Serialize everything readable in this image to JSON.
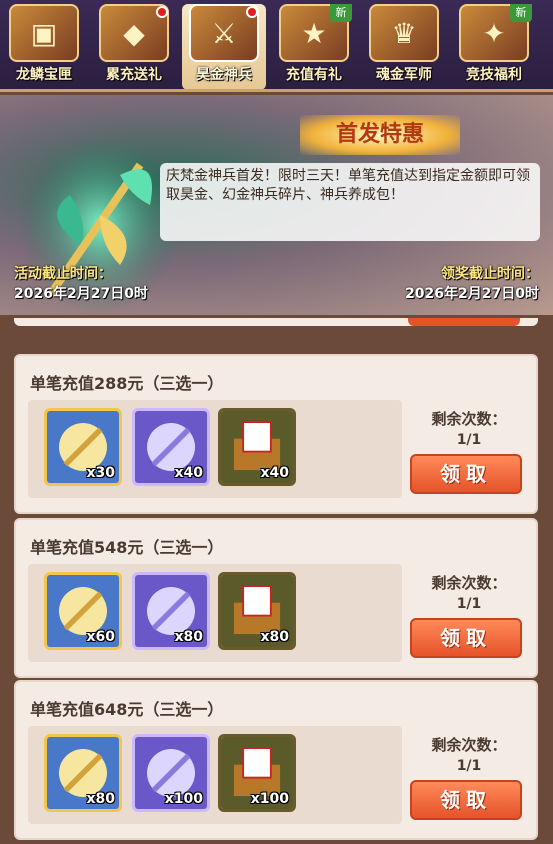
{
  "tabs": [
    {
      "label": "龙鳞宝匣",
      "icon": "treasure-chest-icon",
      "dot": false,
      "new": false,
      "active": false
    },
    {
      "label": "累充送礼",
      "icon": "gift-chest-icon",
      "dot": true,
      "new": false,
      "active": false
    },
    {
      "label": "昊金神兵",
      "icon": "weapon-icon",
      "dot": true,
      "new": false,
      "active": true
    },
    {
      "label": "充值有礼",
      "icon": "coupon-icon",
      "dot": false,
      "new": true,
      "active": false
    },
    {
      "label": "魂金军师",
      "icon": "strategist-icon",
      "dot": false,
      "new": false,
      "active": false
    },
    {
      "label": "竞技福利",
      "icon": "arena-badge-icon",
      "dot": false,
      "new": true,
      "active": false
    }
  ],
  "new_tag": "新",
  "banner": {
    "title": "首发特惠",
    "description": "庆梵金神兵首发！限时三天！单笔充值达到指定金额即可领取昊金、幻金神兵碎片、神兵养成包！",
    "activity_deadline_label": "活动截止时间：",
    "activity_deadline": "2026年2月27日0时",
    "claim_deadline_label": "领奖截止时间：",
    "claim_deadline": "2026年2月27日0时"
  },
  "cards": [
    {
      "title": "单笔充值288元（三选一）",
      "items": [
        {
          "name": "gold-weapon-shard",
          "qty": "x30"
        },
        {
          "name": "purple-weapon-shard",
          "qty": "x40"
        },
        {
          "name": "weapon-pack-chest",
          "qty": "x40"
        }
      ],
      "remain_label": "剩余次数：",
      "remain_count": "1/1",
      "button": "领取"
    },
    {
      "title": "单笔充值548元（三选一）",
      "items": [
        {
          "name": "gold-weapon-shard",
          "qty": "x60"
        },
        {
          "name": "purple-weapon-shard",
          "qty": "x80"
        },
        {
          "name": "weapon-pack-chest",
          "qty": "x80"
        }
      ],
      "remain_label": "剩余次数：",
      "remain_count": "1/1",
      "button": "领取"
    },
    {
      "title": "单笔充值648元（三选一）",
      "items": [
        {
          "name": "gold-weapon-shard",
          "qty": "x80"
        },
        {
          "name": "purple-weapon-shard",
          "qty": "x100"
        },
        {
          "name": "weapon-pack-chest",
          "qty": "x100"
        }
      ],
      "remain_label": "剩余次数：",
      "remain_count": "1/1",
      "button": "领取"
    }
  ],
  "colors": {
    "accent_button": "#e6532a",
    "card_bg": "#f4ebe4",
    "title_gold": "#f2b23a"
  }
}
